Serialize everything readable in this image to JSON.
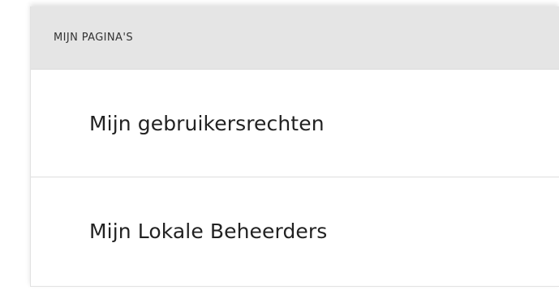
{
  "panel": {
    "title": "MIJN PAGINA'S",
    "items": [
      {
        "label": "Mijn gebruikersrechten"
      },
      {
        "label": "Mijn Lokale Beheerders"
      }
    ]
  }
}
